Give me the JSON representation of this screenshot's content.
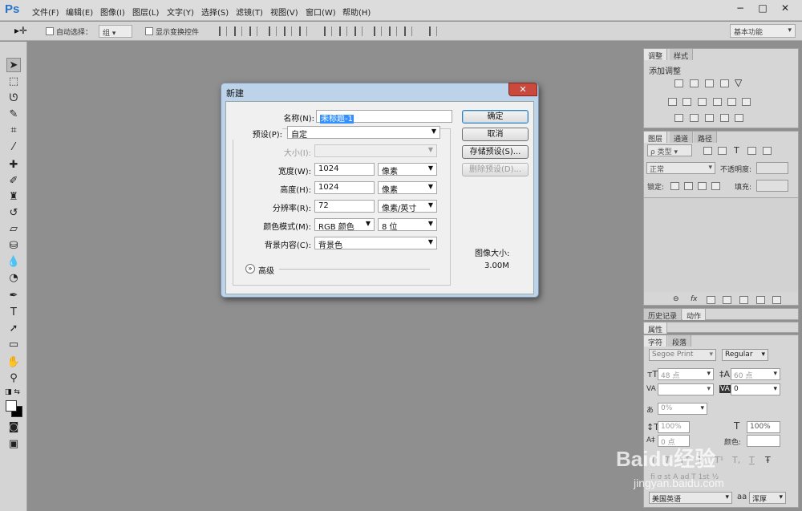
{
  "app": {
    "logo": "Ps",
    "menu": [
      "文件(F)",
      "编辑(E)",
      "图像(I)",
      "图层(L)",
      "文字(Y)",
      "选择(S)",
      "滤镜(T)",
      "视图(V)",
      "窗口(W)",
      "帮助(H)"
    ],
    "window_controls": [
      "−",
      "□",
      "✕"
    ]
  },
  "options_bar": {
    "auto_select_label": "自动选择：",
    "auto_select_value": "组",
    "show_transform_label": "显示变换控件",
    "workspace": "基本功能"
  },
  "panels": {
    "adjust": {
      "tabs": [
        "调整",
        "样式"
      ],
      "title": "添加调整"
    },
    "layers": {
      "tabs": [
        "图层",
        "通道",
        "路径"
      ],
      "filter_label": "ρ 类型",
      "blend_mode": "正常",
      "opacity_label": "不透明度:",
      "lock_label": "锁定:",
      "fill_label": "填充:"
    },
    "history": {
      "tabs": [
        "历史记录",
        "动作"
      ]
    },
    "properties": {
      "tabs": [
        "属性"
      ]
    },
    "character": {
      "tabs": [
        "字符",
        "段落"
      ],
      "font_family": "Segoe Print",
      "font_style": "Regular",
      "font_size": "48 点",
      "leading": "60 点",
      "tracking": "0",
      "tracking_pct": "0%",
      "vscale": "100%",
      "hscale": "100%",
      "baseline": "0 点",
      "color_label": "颜色:",
      "language": "美国英语",
      "aa_label": "aa",
      "aa_value": "浑厚",
      "style_buttons": [
        "T",
        "T",
        "TT",
        "Tr",
        "T¹",
        "T,",
        "T",
        "Ŧ"
      ]
    }
  },
  "dialog": {
    "title": "新建",
    "close": "✕",
    "name_label": "名称(N):",
    "name_value": "未标题-1",
    "preset_label": "预设(P):",
    "preset_value": "自定",
    "size_label": "大小(I):",
    "size_value": "",
    "width_label": "宽度(W):",
    "width_value": "1024",
    "width_unit": "像素",
    "height_label": "高度(H):",
    "height_value": "1024",
    "height_unit": "像素",
    "resolution_label": "分辨率(R):",
    "resolution_value": "72",
    "resolution_unit": "像素/英寸",
    "color_mode_label": "颜色模式(M):",
    "color_mode_value": "RGB 颜色",
    "bit_depth": "8 位",
    "bg_label": "背景内容(C):",
    "bg_value": "背景色",
    "advanced_label": "高级",
    "buttons": {
      "ok": "确定",
      "cancel": "取消",
      "save_preset": "存储预设(S)...",
      "delete_preset": "删除预设(D)..."
    },
    "image_size_label": "图像大小:",
    "image_size_value": "3.00M"
  },
  "watermark": {
    "brand": "Baidu经验",
    "url": "jingyan.baidu.com"
  }
}
